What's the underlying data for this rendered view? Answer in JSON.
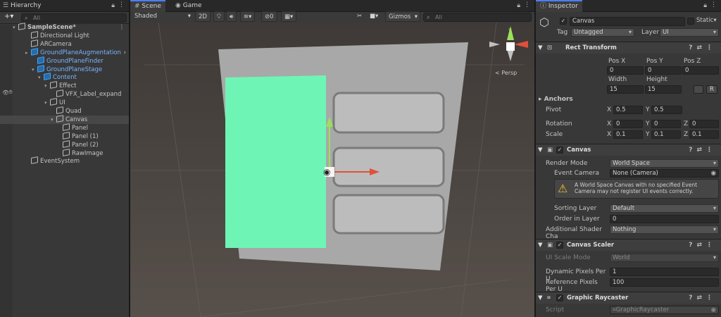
{
  "hierarchy": {
    "tab": "Hierarchy",
    "search_placeholder": "All",
    "add": "+▾",
    "items": [
      {
        "label": "SampleScene*",
        "depth": 0,
        "kind": "scene"
      },
      {
        "label": "Directional Light",
        "depth": 2,
        "kind": "obj"
      },
      {
        "label": "ARCamera",
        "depth": 2,
        "kind": "obj"
      },
      {
        "label": "GroundPlaneAugmentation",
        "depth": 2,
        "kind": "prefab"
      },
      {
        "label": "GroundPlaneFinder",
        "depth": 3,
        "kind": "prefab"
      },
      {
        "label": "GroundPlaneStage",
        "depth": 3,
        "kind": "prefab"
      },
      {
        "label": "Content",
        "depth": 4,
        "kind": "prefab"
      },
      {
        "label": "Effect",
        "depth": 5,
        "kind": "obj"
      },
      {
        "label": "VFX_Label_expand",
        "depth": 6,
        "kind": "obj"
      },
      {
        "label": "UI",
        "depth": 5,
        "kind": "obj"
      },
      {
        "label": "Quad",
        "depth": 6,
        "kind": "obj"
      },
      {
        "label": "Canvas",
        "depth": 6,
        "kind": "obj"
      },
      {
        "label": "Panel",
        "depth": 7,
        "kind": "obj"
      },
      {
        "label": "Panel (1)",
        "depth": 7,
        "kind": "obj"
      },
      {
        "label": "Panel (2)",
        "depth": 7,
        "kind": "obj"
      },
      {
        "label": "RawImage",
        "depth": 7,
        "kind": "obj"
      },
      {
        "label": "EventSystem",
        "depth": 2,
        "kind": "obj"
      }
    ]
  },
  "scene": {
    "tab_scene": "Scene",
    "tab_game": "Game",
    "shading": "Shaded",
    "mode2d": "2D",
    "hidden_count": "0",
    "gizmos": "Gizmos",
    "search_placeholder": "All",
    "gizmo_label": "< Persp"
  },
  "inspector": {
    "tab": "Inspector",
    "object_name": "Canvas",
    "static_label": "Static",
    "tag_label": "Tag",
    "tag_value": "Untagged",
    "layer_label": "Layer",
    "layer_value": "UI",
    "rect": {
      "title": "Rect Transform",
      "posx_l": "Pos X",
      "posy_l": "Pos Y",
      "posz_l": "Pos Z",
      "posx": "0",
      "posy": "0",
      "posz": "0",
      "width_l": "Width",
      "height_l": "Height",
      "width": "15",
      "height": "15",
      "r_btn": "R",
      "anchors": "Anchors",
      "pivot_l": "Pivot",
      "pivot_x": "0.5",
      "pivot_y": "0.5",
      "rotation_l": "Rotation",
      "rot_x": "0",
      "rot_y": "0",
      "rot_z": "0",
      "scale_l": "Scale",
      "scale_x": "0.1",
      "scale_y": "0.1",
      "scale_z": "0.1",
      "x": "X",
      "y": "Y",
      "z": "Z"
    },
    "canvas": {
      "title": "Canvas",
      "render_mode_l": "Render Mode",
      "render_mode": "World Space",
      "event_camera_l": "Event Camera",
      "event_camera": "None (Camera)",
      "warning": "A World Space Canvas with no specified Event Camera may not register UI events correctly.",
      "sorting_layer_l": "Sorting Layer",
      "sorting_layer": "Default",
      "order_l": "Order in Layer",
      "order": "0",
      "shader_l": "Additional Shader Cha",
      "shader": "Nothing"
    },
    "scaler": {
      "title": "Canvas Scaler",
      "ui_scale_l": "UI Scale Mode",
      "ui_scale": "World",
      "dpu_l": "Dynamic Pixels Per U",
      "dpu": "1",
      "rpu_l": "Reference Pixels Per U",
      "rpu": "100"
    },
    "raycaster": {
      "title": "Graphic Raycaster",
      "script_l": "Script",
      "script": "GraphicRaycaster"
    }
  },
  "colors": {
    "accent": "#4c7eff",
    "green_panel": "#6ef5b5",
    "bg": "#383838"
  }
}
